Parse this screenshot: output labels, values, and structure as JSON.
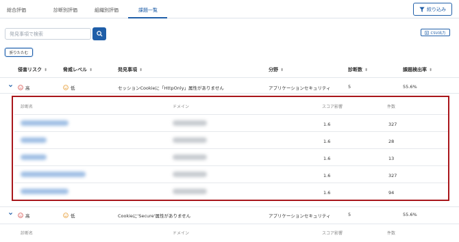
{
  "tabs": [
    {
      "label": "総合評価"
    },
    {
      "label": "診断別評価"
    },
    {
      "label": "組織別評価"
    },
    {
      "label": "課題一覧"
    }
  ],
  "filter_button": {
    "label": "絞り込み",
    "icon": "filter-icon"
  },
  "search": {
    "placeholder": "発見事項で検索",
    "icon": "search-icon"
  },
  "csv_button": {
    "label": "CSV出力",
    "icon": "download-icon"
  },
  "collapse_button": {
    "label": "折りたたむ"
  },
  "columns": [
    {
      "label": "侵害リスク"
    },
    {
      "label": "脅威レベル"
    },
    {
      "label": "発見事項"
    },
    {
      "label": "分野"
    },
    {
      "label": "診断数"
    },
    {
      "label": "課題検出率"
    }
  ],
  "issues": [
    {
      "risk": "高",
      "threat": "低",
      "finding": "セッションCookieに「HttpOnly」属性がありません",
      "field": "アプリケーションセキュリティ",
      "count": "5",
      "rate": "55.6%"
    },
    {
      "risk": "高",
      "threat": "低",
      "finding": "Cookieに'Secure'属性がありません",
      "field": "アプリケーションセキュリティ",
      "count": "5",
      "rate": "55.6%"
    }
  ],
  "detail_columns": [
    {
      "label": "診断名"
    },
    {
      "label": "ドメイン"
    },
    {
      "label": "スコア影響"
    },
    {
      "label": "件数"
    }
  ],
  "detail_rows": [
    {
      "score": "1.6",
      "count": "327"
    },
    {
      "score": "1.6",
      "count": "28"
    },
    {
      "score": "1.6",
      "count": "13"
    },
    {
      "score": "1.6",
      "count": "327"
    },
    {
      "score": "1.6",
      "count": "94"
    }
  ],
  "colors": {
    "accent": "#1f5ea8",
    "highlight_border": "#a8151a",
    "risk_high": "#d9534f",
    "threat_low": "#e69a2e"
  }
}
